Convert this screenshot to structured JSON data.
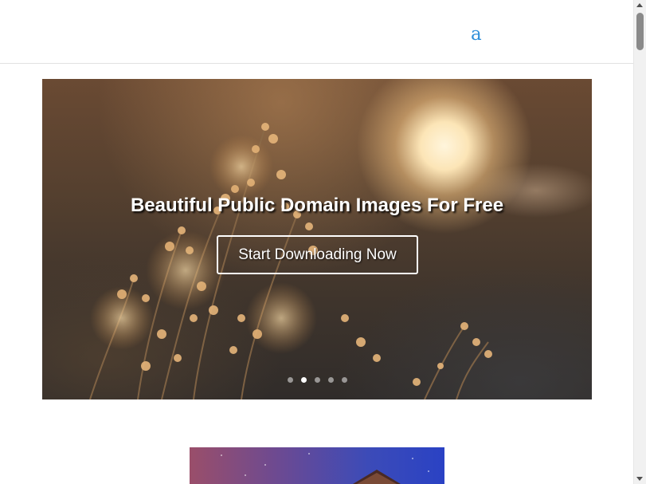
{
  "header": {
    "logo_text": "a",
    "logo_color": "#2f8fd9"
  },
  "hero": {
    "title": "Beautiful Public Domain Images For Free",
    "button_label": "Start Downloading Now",
    "slides_total": 5,
    "active_slide": 2,
    "dots": [
      {
        "label": "slide-1",
        "active": false
      },
      {
        "label": "slide-2",
        "active": true
      },
      {
        "label": "slide-3",
        "active": false
      },
      {
        "label": "slide-4",
        "active": false
      },
      {
        "label": "slide-5",
        "active": false
      }
    ],
    "photo_subject": "backlit wildflowers at sunset"
  },
  "content": {
    "thumbnail_subject": "building rooftop against purple twilight sky"
  },
  "scrollbar": {
    "position": 0.0
  }
}
